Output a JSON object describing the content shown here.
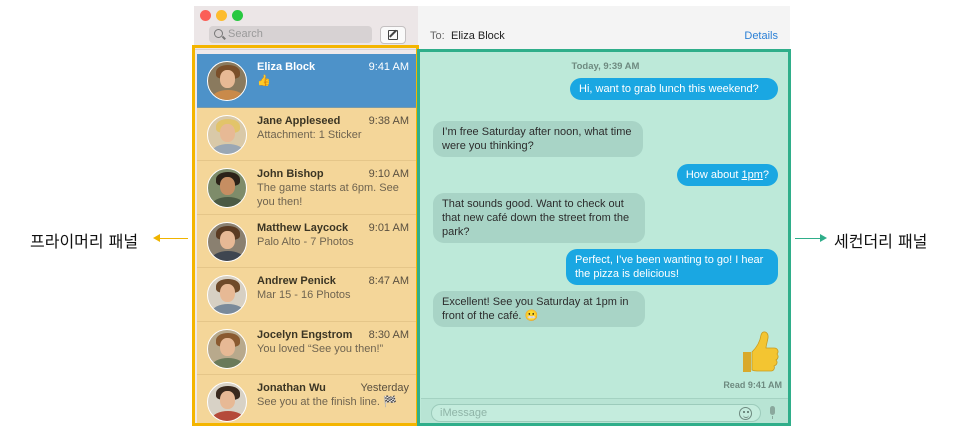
{
  "callouts": {
    "primary": "프라이머리 패널",
    "secondary": "세컨더리 패널",
    "primary_color": "#f4b500",
    "secondary_color": "#2fae8a"
  },
  "sidebar": {
    "search_placeholder": "Search",
    "conversations": [
      {
        "name": "Eliza Block",
        "time": "9:41 AM",
        "preview": "👍",
        "selected": true
      },
      {
        "name": "Jane Appleseed",
        "time": "9:38 AM",
        "preview": "Attachment: 1 Sticker"
      },
      {
        "name": "John Bishop",
        "time": "9:10 AM",
        "preview": "The game starts at 6pm. See you then!"
      },
      {
        "name": "Matthew Laycock",
        "time": "9:01 AM",
        "preview": "Palo Alto - 7 Photos"
      },
      {
        "name": "Andrew Penick",
        "time": "8:47 AM",
        "preview": "Mar 15 - 16 Photos"
      },
      {
        "name": "Jocelyn Engstrom",
        "time": "8:30 AM",
        "preview": "You loved “See you then!”"
      },
      {
        "name": "Jonathan Wu",
        "time": "Yesterday",
        "preview": "See you at the finish line. 🏁"
      }
    ]
  },
  "detail": {
    "to_label": "To:",
    "to_name": "Eliza Block",
    "details_label": "Details",
    "day_stamp": "Today, 9:39 AM",
    "messages": [
      {
        "dir": "out",
        "text": "Hi, want to grab lunch this weekend?"
      },
      {
        "dir": "in",
        "text": "I’m free Saturday after noon, what time were you thinking?"
      },
      {
        "dir": "out",
        "text_before": "How about ",
        "link": "1pm",
        "text_after": "?"
      },
      {
        "dir": "in",
        "text": "That sounds good. Want to check out that new café down the street from the park?"
      },
      {
        "dir": "out",
        "text": "Perfect, I’ve been wanting to go! I hear the pizza is delicious!"
      },
      {
        "dir": "in",
        "text": "Excellent! See you Saturday at 1pm in front of the café. 😬"
      }
    ],
    "thumb": "thumbs-up-icon",
    "read_receipt": "Read 9:41 AM",
    "input_placeholder": "iMessage"
  }
}
